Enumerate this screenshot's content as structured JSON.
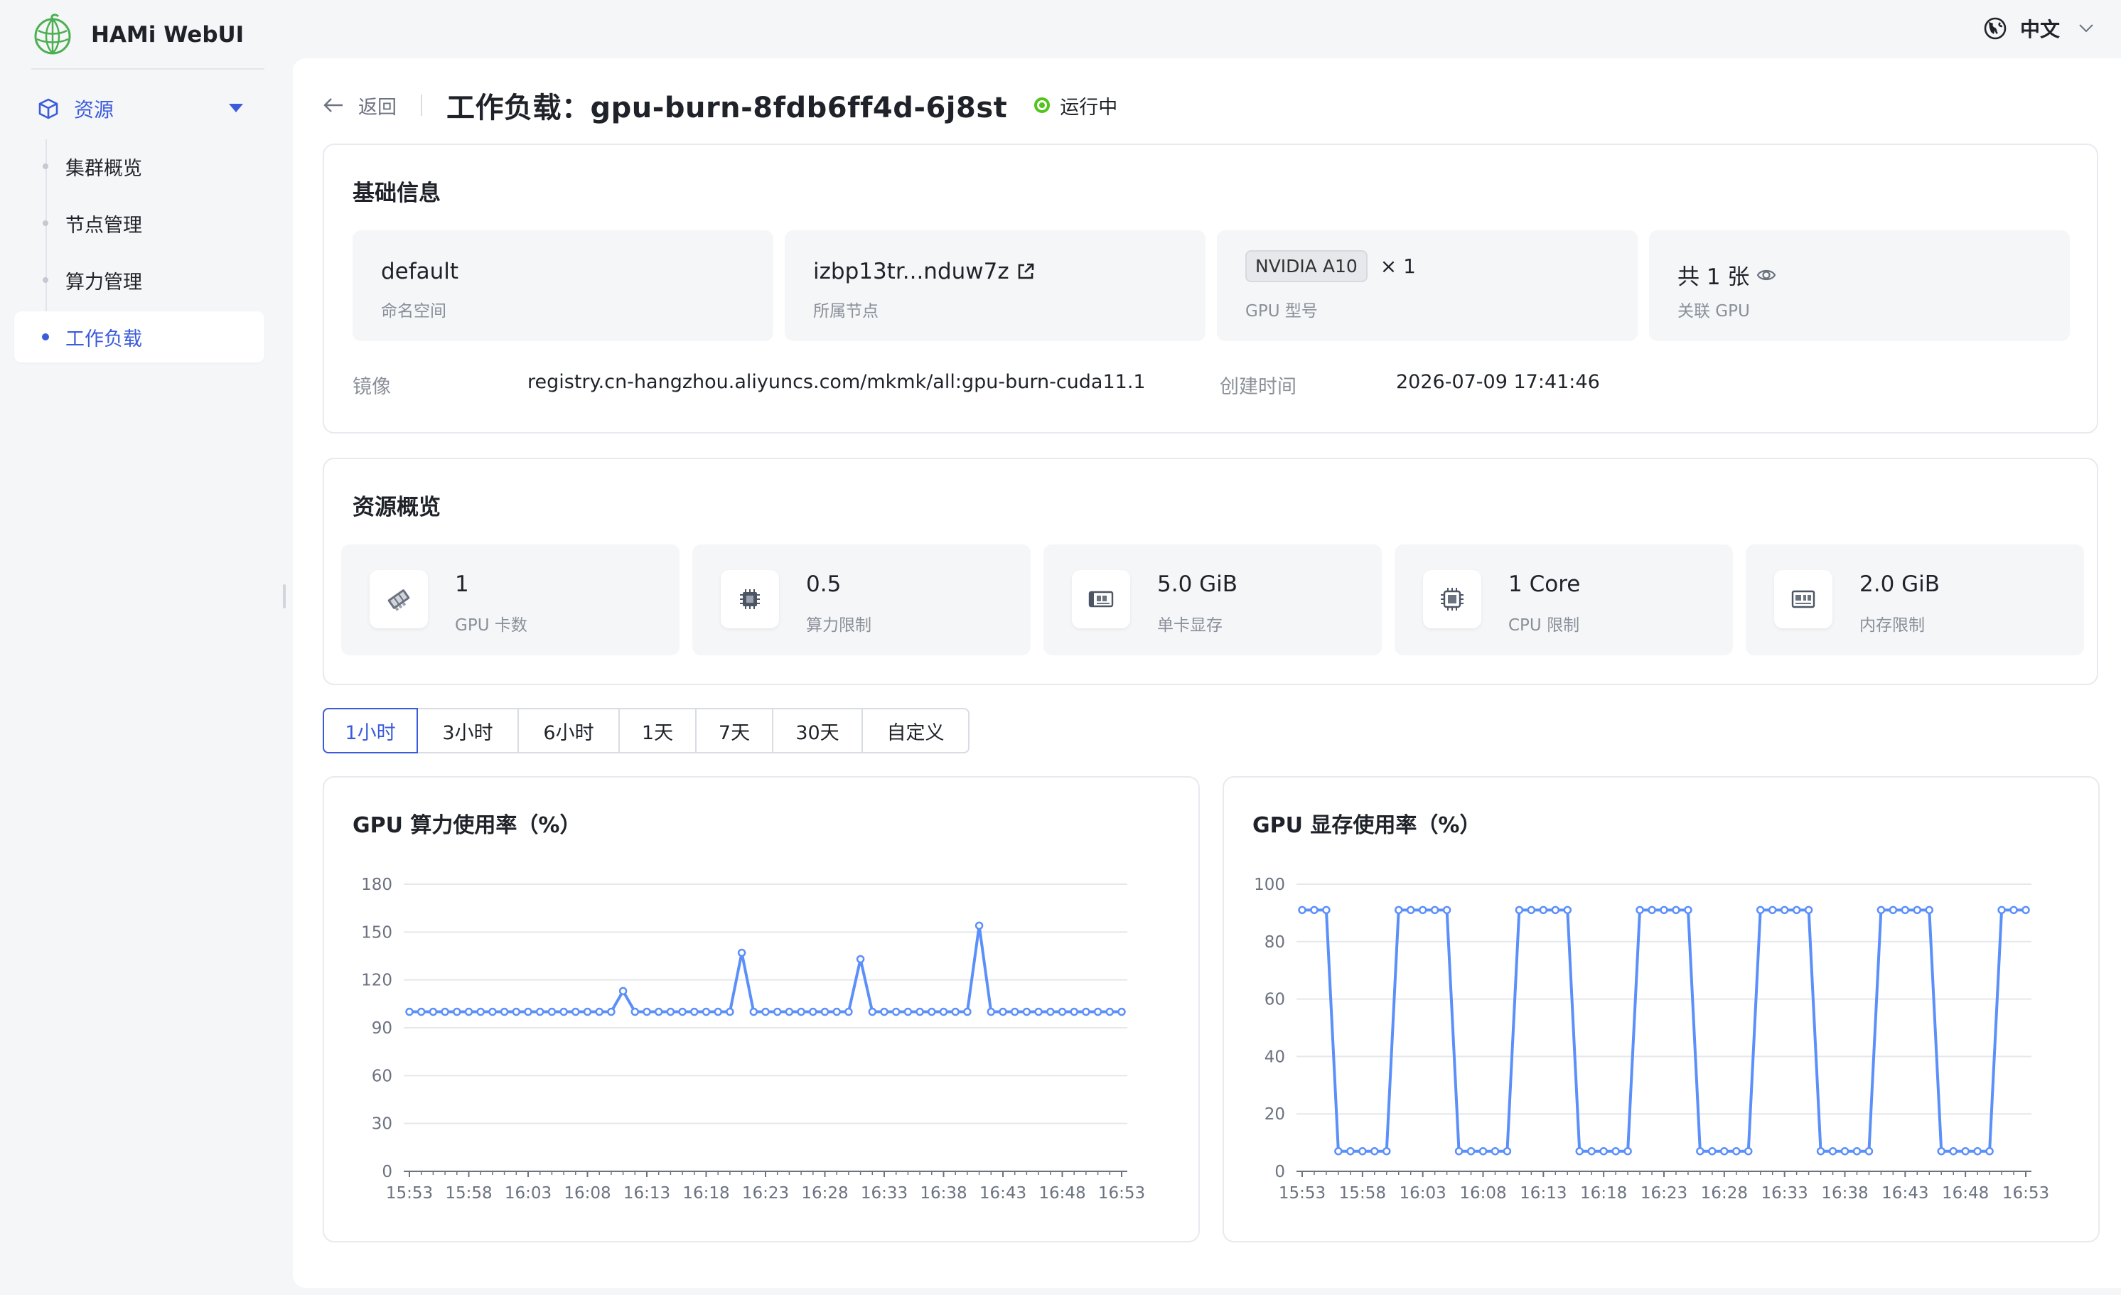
{
  "app": {
    "title": "HAMi WebUI",
    "language": "中文"
  },
  "sidebar": {
    "group_label": "资源",
    "items": [
      {
        "label": "集群概览"
      },
      {
        "label": "节点管理"
      },
      {
        "label": "算力管理"
      },
      {
        "label": "工作负载",
        "active": true
      }
    ]
  },
  "header": {
    "back_label": "返回",
    "title": "工作负载：gpu-burn-8fdb6ff4d-6j8st",
    "status": "运行中",
    "status_color": "#52c41a"
  },
  "basic_info": {
    "title": "基础信息",
    "boxes": [
      {
        "value": "default",
        "label": "命名空间"
      },
      {
        "value": "izbp13tr...nduw7z",
        "label": "所属节点"
      },
      {
        "value_tag": "NVIDIA A10",
        "value_suffix": "× 1",
        "label": "GPU 型号"
      },
      {
        "value": "共 1 张",
        "label": "关联 GPU"
      }
    ],
    "image_label": "镜像",
    "image_value": "registry.cn-hangzhou.aliyuncs.com/mkmk/all:gpu-burn-cuda11.1",
    "created_label": "创建时间",
    "created_value": "2026-07-09 17:41:46"
  },
  "resources": {
    "title": "资源概览",
    "items": [
      {
        "value": "1",
        "label": "GPU 卡数",
        "icon": "gpu-card-icon"
      },
      {
        "value": "0.5",
        "label": "算力限制",
        "icon": "chip-icon"
      },
      {
        "value": "5.0 GiB",
        "label": "单卡显存",
        "icon": "memory-card-icon"
      },
      {
        "value": "1 Core",
        "label": "CPU 限制",
        "icon": "cpu-icon"
      },
      {
        "value": "2.0 GiB",
        "label": "内存限制",
        "icon": "ram-icon"
      }
    ]
  },
  "time_ranges": {
    "options": [
      "1小时",
      "3小时",
      "6小时",
      "1天",
      "7天",
      "30天",
      "自定义"
    ],
    "selected": "1小时"
  },
  "colors": {
    "accent": "#3b5bdb",
    "series": "#5b8ff9"
  },
  "chart_data": [
    {
      "type": "line",
      "title": "GPU 算力使用率（%）",
      "ylim": [
        0,
        180
      ],
      "yticks": [
        0,
        30,
        60,
        90,
        120,
        150,
        180
      ],
      "xticks": [
        "15:53",
        "15:58",
        "16:03",
        "16:08",
        "16:13",
        "16:18",
        "16:23",
        "16:28",
        "16:33",
        "16:38",
        "16:43",
        "16:48",
        "16:53"
      ],
      "grid": true,
      "series": [
        {
          "values": [
            100,
            100,
            100,
            100,
            100,
            100,
            100,
            100,
            100,
            100,
            100,
            100,
            100,
            100,
            100,
            100,
            100,
            100,
            113,
            100,
            100,
            100,
            100,
            100,
            100,
            100,
            100,
            100,
            137,
            100,
            100,
            100,
            100,
            100,
            100,
            100,
            100,
            100,
            133,
            100,
            100,
            100,
            100,
            100,
            100,
            100,
            100,
            100,
            154,
            100,
            100,
            100,
            100,
            100,
            100,
            100,
            100,
            100,
            100,
            100,
            100
          ]
        }
      ]
    },
    {
      "type": "line",
      "title": "GPU 显存使用率（%）",
      "ylim": [
        0,
        100
      ],
      "yticks": [
        0,
        20,
        40,
        60,
        80,
        100
      ],
      "xticks": [
        "15:53",
        "15:58",
        "16:03",
        "16:08",
        "16:13",
        "16:18",
        "16:23",
        "16:28",
        "16:33",
        "16:38",
        "16:43",
        "16:48",
        "16:53"
      ],
      "grid": true,
      "series": [
        {
          "values": [
            91,
            91,
            91,
            7,
            7,
            7,
            7,
            7,
            91,
            91,
            91,
            91,
            91,
            7,
            7,
            7,
            7,
            7,
            91,
            91,
            91,
            91,
            91,
            7,
            7,
            7,
            7,
            7,
            91,
            91,
            91,
            91,
            91,
            7,
            7,
            7,
            7,
            7,
            91,
            91,
            91,
            91,
            91,
            7,
            7,
            7,
            7,
            7,
            91,
            91,
            91,
            91,
            91,
            7,
            7,
            7,
            7,
            7,
            91,
            91,
            91
          ]
        }
      ]
    }
  ]
}
